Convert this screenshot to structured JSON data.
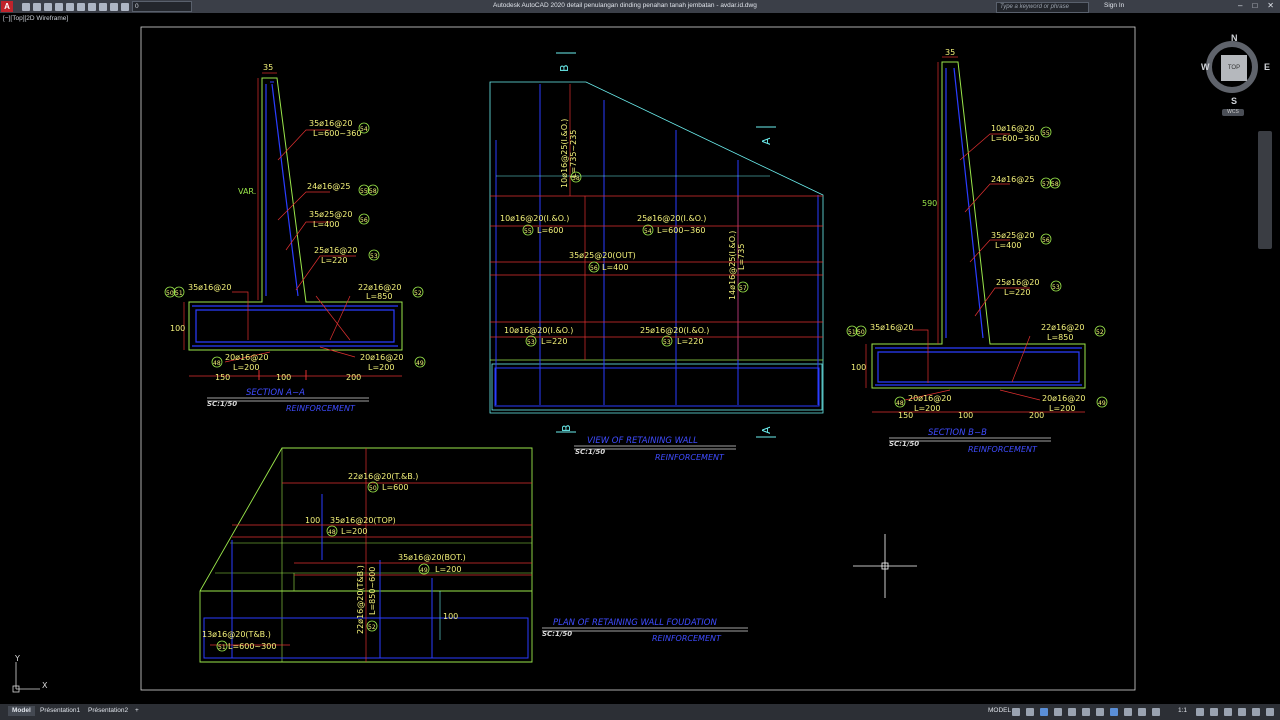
{
  "title_bar": {
    "app_title": "Autodesk AutoCAD 2020    detail penulangan dinding penahan tanah jembatan - avdar.id.dwg",
    "search_placeholder": "Type a keyword or phrase",
    "sign_in": "Sign In",
    "layer_value": "0",
    "logo": "A",
    "icons": [
      "new-icon",
      "open-icon",
      "save-icon",
      "saveas-icon",
      "print-icon",
      "undo-icon",
      "redo-icon",
      "lightbulb-icon",
      "sun-icon",
      "square-icon"
    ]
  },
  "viewport": {
    "view_label": "[−][Top][2D Wireframe]",
    "viewcube": {
      "top": "TOP",
      "north": "N",
      "south": "S",
      "east": "E",
      "west": "W",
      "wcs": "WCS"
    },
    "ucs": {
      "x": "X",
      "y": "Y"
    }
  },
  "drawing": {
    "section_a": {
      "title": "SECTION   A−A",
      "scale": "SC:1/50",
      "subtitle": "REINFORCEMENT",
      "dims": {
        "top": "35",
        "height": "VAR.",
        "base": "100",
        "left": "150",
        "mid": "100",
        "right": "200"
      },
      "labels": [
        {
          "text": "35ø16@20",
          "sub": "L=600~360",
          "mark": "54"
        },
        {
          "text": "24ø16@25",
          "mark": "55",
          "mark2": "58"
        },
        {
          "text": "35ø25@20",
          "sub": "L=400",
          "mark": "56"
        },
        {
          "text": "25ø16@20",
          "sub": "L=220",
          "mark": "53"
        },
        {
          "text": "35ø16@20",
          "mark": "50",
          "mark2": "51"
        },
        {
          "text": "22ø16@20",
          "sub": "L=850",
          "mark": "52"
        },
        {
          "text": "20ø16@20",
          "sub": "L=200",
          "mark": "48"
        },
        {
          "text": "20ø16@20",
          "sub": "L=200",
          "mark": "49"
        }
      ]
    },
    "section_b": {
      "title": "SECTION   B−B",
      "scale": "SC:1/50",
      "subtitle": "REINFORCEMENT",
      "dims": {
        "top": "35",
        "height": "590",
        "base": "100",
        "left": "150",
        "mid": "100",
        "right": "200"
      },
      "labels": [
        {
          "text": "10ø16@20",
          "sub": "L=600~360",
          "mark": "55"
        },
        {
          "text": "24ø16@25",
          "mark": "57",
          "mark2": "58"
        },
        {
          "text": "35ø25@20",
          "sub": "L=400",
          "mark": "56"
        },
        {
          "text": "25ø16@20",
          "sub": "L=220",
          "mark": "53"
        },
        {
          "text": "35ø16@20",
          "mark": "51",
          "mark2": "50"
        },
        {
          "text": "22ø16@20",
          "sub": "L=850",
          "mark": "52"
        },
        {
          "text": "20ø16@20",
          "sub": "L=200",
          "mark": "48"
        },
        {
          "text": "20ø16@20",
          "sub": "L=200",
          "mark": "49"
        }
      ]
    },
    "view": {
      "title": "VIEW  OF  RETAINING  WALL",
      "scale": "SC:1/50",
      "subtitle": "REINFORCEMENT",
      "cut_b": "B",
      "cut_a": "A",
      "labels": {
        "vert_left": "10ø16@25(I.&O.)",
        "vert_left_sub": "L=735~235",
        "vert_left_mark": "58",
        "l1": "10ø16@20(I.&O.)",
        "l1_sub": "L=600",
        "l1_mark": "55",
        "l2": "25ø16@20(I.&O.)",
        "l2_sub": "L=600~360",
        "l2_mark": "54",
        "l3": "35ø25@20(OUT)",
        "l3_sub": "L=400",
        "l3_mark": "56",
        "vert_right": "14ø16@25(I.&O.)",
        "vert_right_sub": "L=735",
        "vert_right_mark": "57",
        "l4": "10ø16@20(I.&O.)",
        "l4_sub": "L=220",
        "l4_mark": "53",
        "l5": "25ø16@20(I.&O.)",
        "l5_sub": "L=220",
        "l5_mark": "53"
      }
    },
    "plan": {
      "title": "PLAN  OF  RETAINING  WALL  FOUDATION",
      "scale": "SC:1/50",
      "subtitle": "REINFORCEMENT",
      "labels": {
        "p1": "22ø16@20(T.&B.)",
        "p1_sub": "L=600",
        "p1_mark": "50",
        "p2_dim": "100",
        "p2": "35ø16@20(TOP)",
        "p2_sub": "L=200",
        "p2_mark": "48",
        "p3": "35ø16@20(BOT.)",
        "p3_sub": "L=200",
        "p3_mark": "49",
        "p4": "22ø16@20(T&B.)",
        "p4_sub": "L=850~600",
        "p4_mark": "52",
        "p5_dim": "100",
        "p6": "13ø16@20(T&B.)",
        "p6_sub": "L=600~300",
        "p6_mark": "51"
      }
    }
  },
  "status_bar": {
    "tabs": [
      "Model",
      "Présentation1",
      "Présentation2"
    ],
    "add_tab": "+",
    "mode": "MODEL",
    "scale": "1:1"
  },
  "colors": {
    "structure": "#9ae64a",
    "rebar": "#2a3dff",
    "dimension": "#e03030",
    "text": "#f4f27a",
    "cyan": "#6cf0f0",
    "title": "#3f4cff"
  }
}
